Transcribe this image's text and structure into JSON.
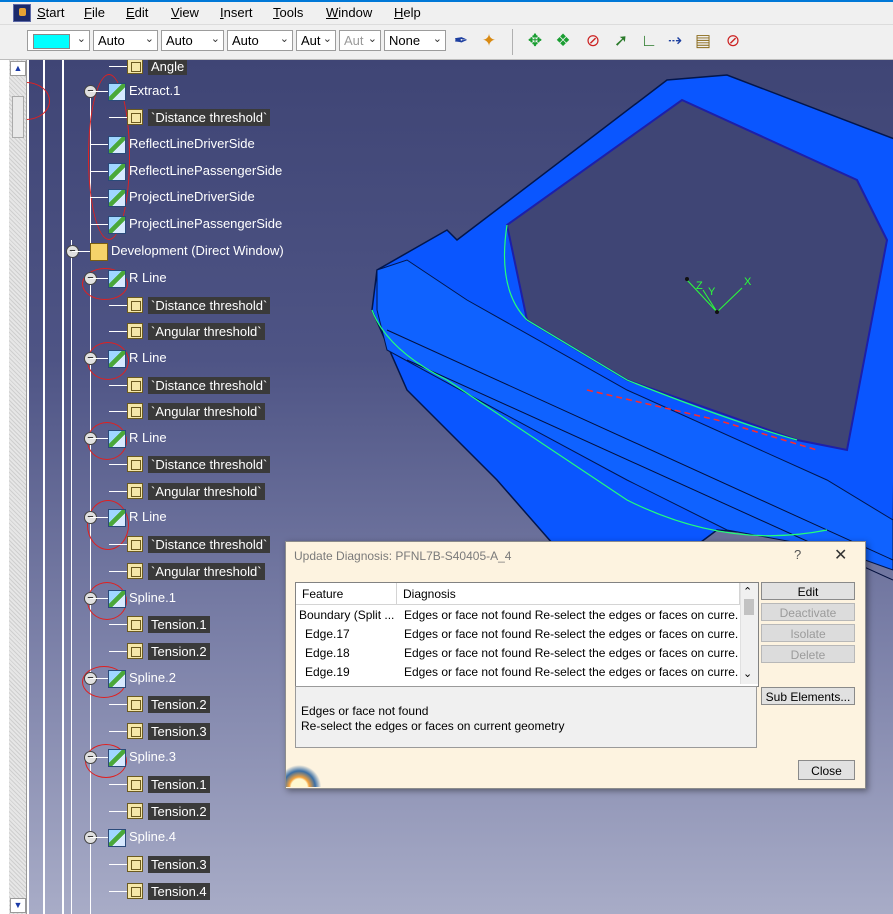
{
  "menu": [
    "Start",
    "File",
    "Edit",
    "View",
    "Insert",
    "Tools",
    "Window",
    "Help"
  ],
  "toolbar": {
    "combos": [
      {
        "value": "",
        "color": "#00ffff"
      },
      {
        "value": "Auto"
      },
      {
        "value": "Auto"
      },
      {
        "value": "Auto"
      },
      {
        "value": "Aut"
      },
      {
        "value": "Aut",
        "disabled": true
      },
      {
        "value": "None"
      }
    ],
    "icons": [
      "paintbrush-icon",
      "magic-wand-icon",
      "move-arrows-icon",
      "rotate-arrows-icon",
      "deactivate-pin-icon",
      "sketch-point-icon",
      "line-tool-icon",
      "dimension-tool-icon",
      "ruler-icon",
      "no-entry-pin-icon"
    ]
  },
  "tree": {
    "nodes": [
      {
        "label": "Angle",
        "kind": "param",
        "indent": 2,
        "partial": true
      },
      {
        "label": "Extract.1",
        "kind": "geo",
        "indent": 1,
        "expanded": true
      },
      {
        "label": "`Distance threshold`",
        "kind": "param",
        "indent": 2
      },
      {
        "label": "ReflectLineDriverSide",
        "kind": "geo",
        "indent": 1
      },
      {
        "label": "ReflectLinePassengerSide",
        "kind": "geo",
        "indent": 1
      },
      {
        "label": "ProjectLineDriverSide",
        "kind": "geo",
        "indent": 1
      },
      {
        "label": "ProjectLinePassengerSide",
        "kind": "geo",
        "indent": 1
      },
      {
        "label": "Development (Direct Window)",
        "kind": "folder",
        "indent": 0,
        "expanded": true
      },
      {
        "label": "R Line",
        "kind": "geo",
        "indent": 1,
        "expanded": true
      },
      {
        "label": "`Distance threshold`",
        "kind": "param",
        "indent": 2
      },
      {
        "label": "`Angular threshold`",
        "kind": "param",
        "indent": 2
      },
      {
        "label": "R Line",
        "kind": "geo",
        "indent": 1,
        "expanded": true
      },
      {
        "label": "`Distance threshold`",
        "kind": "param",
        "indent": 2
      },
      {
        "label": "`Angular threshold`",
        "kind": "param",
        "indent": 2
      },
      {
        "label": "R Line",
        "kind": "geo",
        "indent": 1,
        "expanded": true
      },
      {
        "label": "`Distance threshold`",
        "kind": "param",
        "indent": 2
      },
      {
        "label": "`Angular threshold`",
        "kind": "param",
        "indent": 2
      },
      {
        "label": "R Line",
        "kind": "geo",
        "indent": 1,
        "expanded": true
      },
      {
        "label": "`Distance threshold`",
        "kind": "param",
        "indent": 2
      },
      {
        "label": "`Angular threshold`",
        "kind": "param",
        "indent": 2
      },
      {
        "label": "Spline.1",
        "kind": "geo",
        "indent": 1,
        "expanded": true
      },
      {
        "label": "Tension.1",
        "kind": "param",
        "indent": 2
      },
      {
        "label": "Tension.2",
        "kind": "param",
        "indent": 2
      },
      {
        "label": "Spline.2",
        "kind": "geo",
        "indent": 1,
        "expanded": true
      },
      {
        "label": "Tension.2",
        "kind": "param",
        "indent": 2
      },
      {
        "label": "Tension.3",
        "kind": "param",
        "indent": 2
      },
      {
        "label": "Spline.3",
        "kind": "geo",
        "indent": 1,
        "expanded": true
      },
      {
        "label": "Tension.1",
        "kind": "param",
        "indent": 2
      },
      {
        "label": "Tension.2",
        "kind": "param",
        "indent": 2
      },
      {
        "label": "Spline.4",
        "kind": "geo",
        "indent": 1,
        "expanded": true
      },
      {
        "label": "Tension.3",
        "kind": "param",
        "indent": 2
      },
      {
        "label": "Tension.4",
        "kind": "param",
        "indent": 2
      }
    ]
  },
  "dialog": {
    "title": "Update Diagnosis: PFNL7B-S40405-A_4",
    "help": "?",
    "close": "✕",
    "columns": [
      "Feature",
      "Diagnosis"
    ],
    "rows": [
      {
        "feature": "Boundary (Split ...",
        "diagnosis": "Edges or face not found Re-select the edges or faces on curre..."
      },
      {
        "feature": "Edge.17",
        "diagnosis": "Edges or face not found Re-select the edges or faces on curre..."
      },
      {
        "feature": "Edge.18",
        "diagnosis": "Edges or face not found Re-select the edges or faces on curre..."
      },
      {
        "feature": "Edge.19",
        "diagnosis": "Edges or face not found Re-select the edges or faces on curre..."
      }
    ],
    "buttons": {
      "edit": "Edit",
      "deactivate": "Deactivate",
      "isolate": "Isolate",
      "delete": "Delete",
      "sub_elements": "Sub Elements...",
      "close": "Close"
    },
    "detail_line1": "Edges or face not found",
    "detail_line2": "Re-select the edges or faces on current geometry"
  },
  "axis": {
    "x": "X",
    "y": "Y",
    "z": "Z"
  }
}
